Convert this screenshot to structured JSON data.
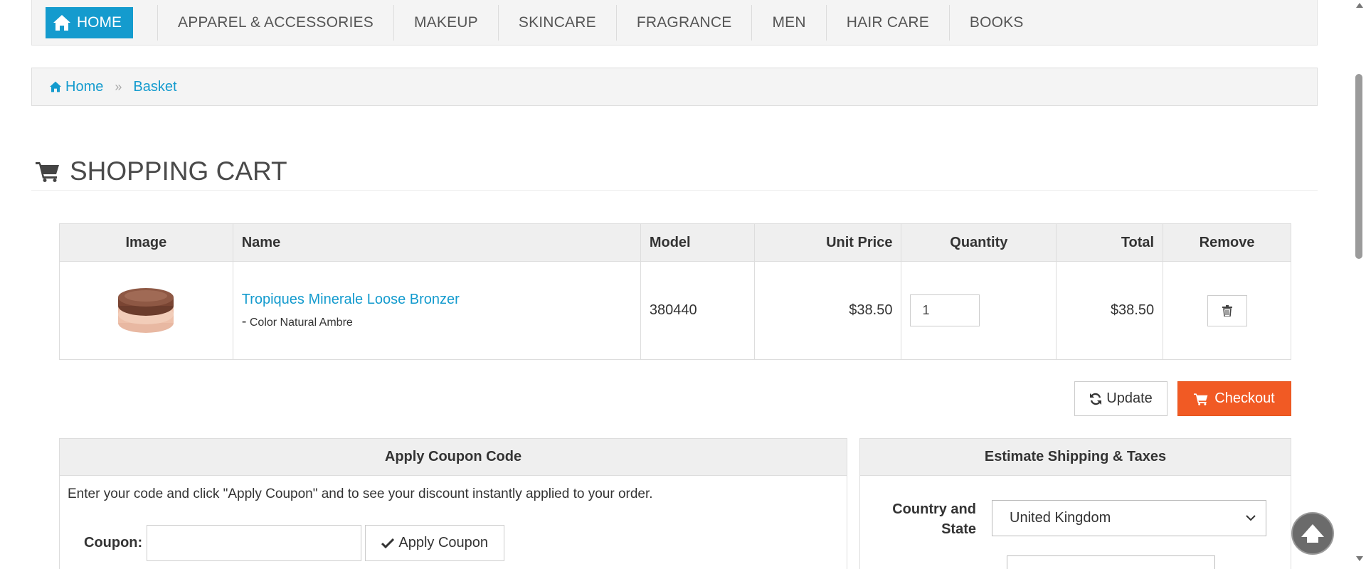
{
  "nav": {
    "home_label": "HOME",
    "items": [
      "APPAREL & ACCESSORIES",
      "MAKEUP",
      "SKINCARE",
      "FRAGRANCE",
      "MEN",
      "HAIR CARE",
      "BOOKS"
    ]
  },
  "breadcrumb": {
    "home": "Home",
    "current": "Basket"
  },
  "page_title": "SHOPPING CART",
  "cart": {
    "headers": {
      "image": "Image",
      "name": "Name",
      "model": "Model",
      "unit_price": "Unit Price",
      "quantity": "Quantity",
      "total": "Total",
      "remove": "Remove"
    },
    "rows": [
      {
        "name": "Tropiques Minerale Loose Bronzer",
        "option": "Color Natural Ambre",
        "model": "380440",
        "unit_price": "$38.50",
        "quantity": "1",
        "total": "$38.50"
      }
    ]
  },
  "actions": {
    "update": "Update",
    "checkout": "Checkout"
  },
  "coupon": {
    "title": "Apply Coupon Code",
    "description": "Enter your code and click \"Apply Coupon\" and to see your discount instantly applied to your order.",
    "label": "Coupon:",
    "value": "",
    "button": "Apply Coupon"
  },
  "shipping": {
    "title": "Estimate Shipping & Taxes",
    "country_label_line1": "Country and",
    "country_label_line2": "State",
    "country_value": "United Kingdom"
  },
  "colors": {
    "accent": "#149bce",
    "checkout": "#f15a24"
  }
}
